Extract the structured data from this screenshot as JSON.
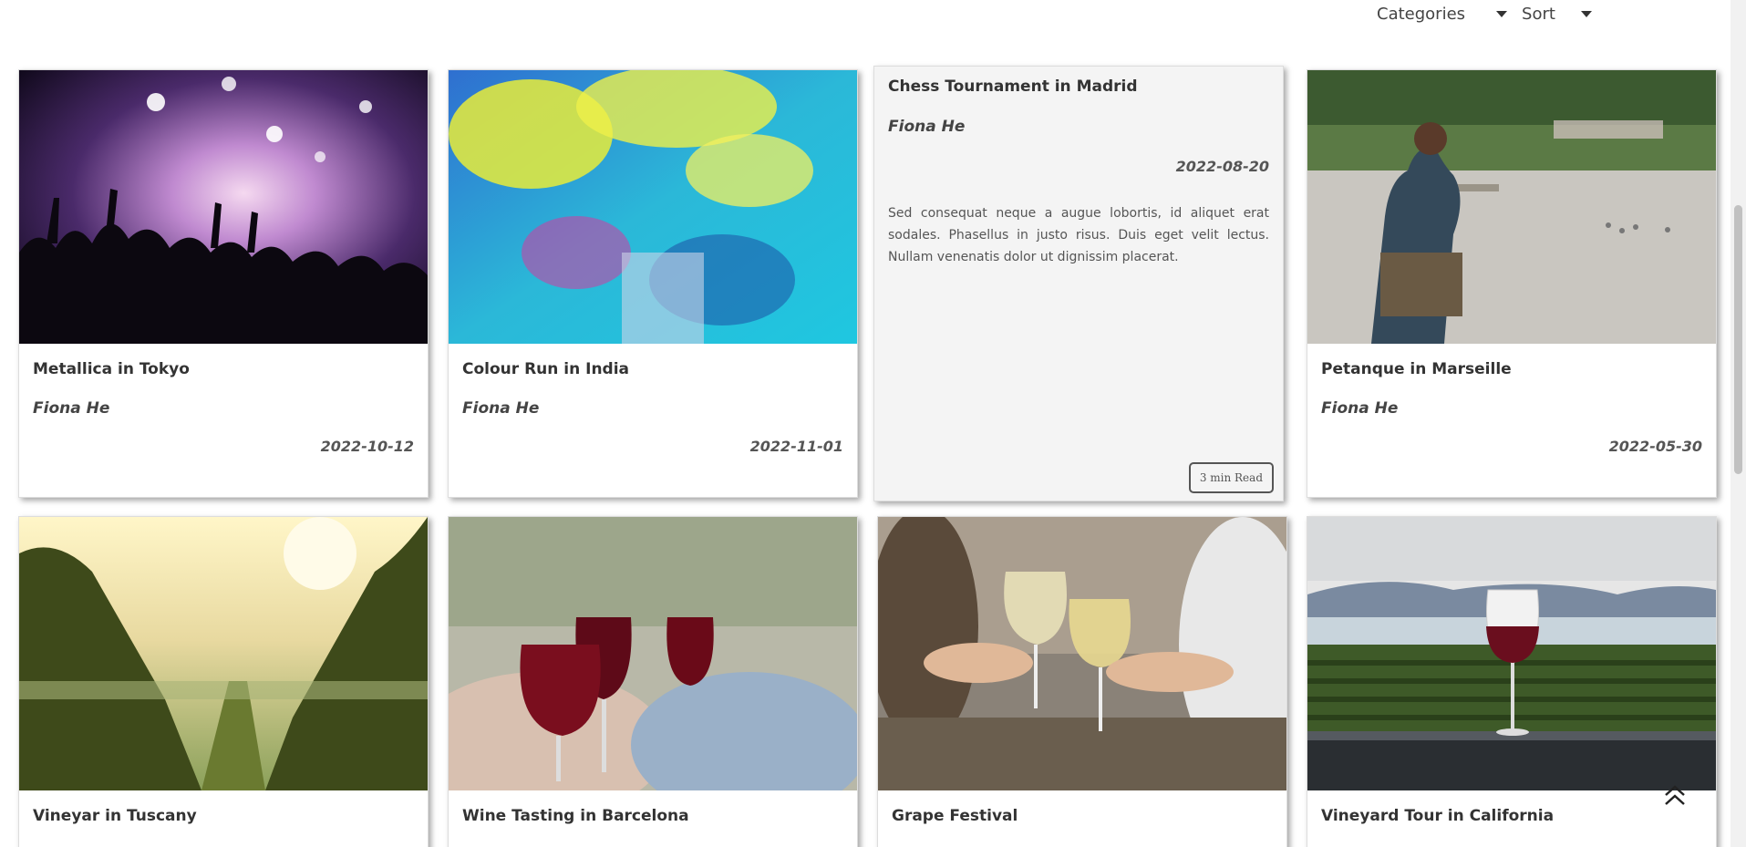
{
  "filters": {
    "categories_label": "Categories",
    "sort_label": "Sort"
  },
  "cards": [
    {
      "title": "Metallica in Tokyo",
      "author": "Fiona He",
      "date": "2022-10-12",
      "image": "concert-crowd"
    },
    {
      "title": "Colour Run in India",
      "author": "Fiona He",
      "date": "2022-11-01",
      "image": "colour-powder"
    },
    {
      "title": "Chess Tournament in Madrid",
      "author": "Fiona He",
      "date": "2022-08-20",
      "excerpt": "Sed consequat neque a augue lobortis, id aliquet erat sodales. Phasellus in justo risus. Duis eget velit lectus. Nullam venenatis dolor ut dignissim placerat.",
      "read_time": "3 min Read"
    },
    {
      "title": "Petanque in Marseille",
      "author": "Fiona He",
      "date": "2022-05-30",
      "image": "petanque-park"
    },
    {
      "title": "Vineyar in Tuscany",
      "image": "vineyard-sunset"
    },
    {
      "title": "Wine Tasting in Barcelona",
      "image": "red-wine-toast"
    },
    {
      "title": "Grape Festival",
      "image": "white-wine-toast"
    },
    {
      "title": "Vineyard Tour in California",
      "image": "wine-glass-vineyard"
    }
  ],
  "icons": {
    "back_to_top": "double-chevron-up-icon"
  }
}
